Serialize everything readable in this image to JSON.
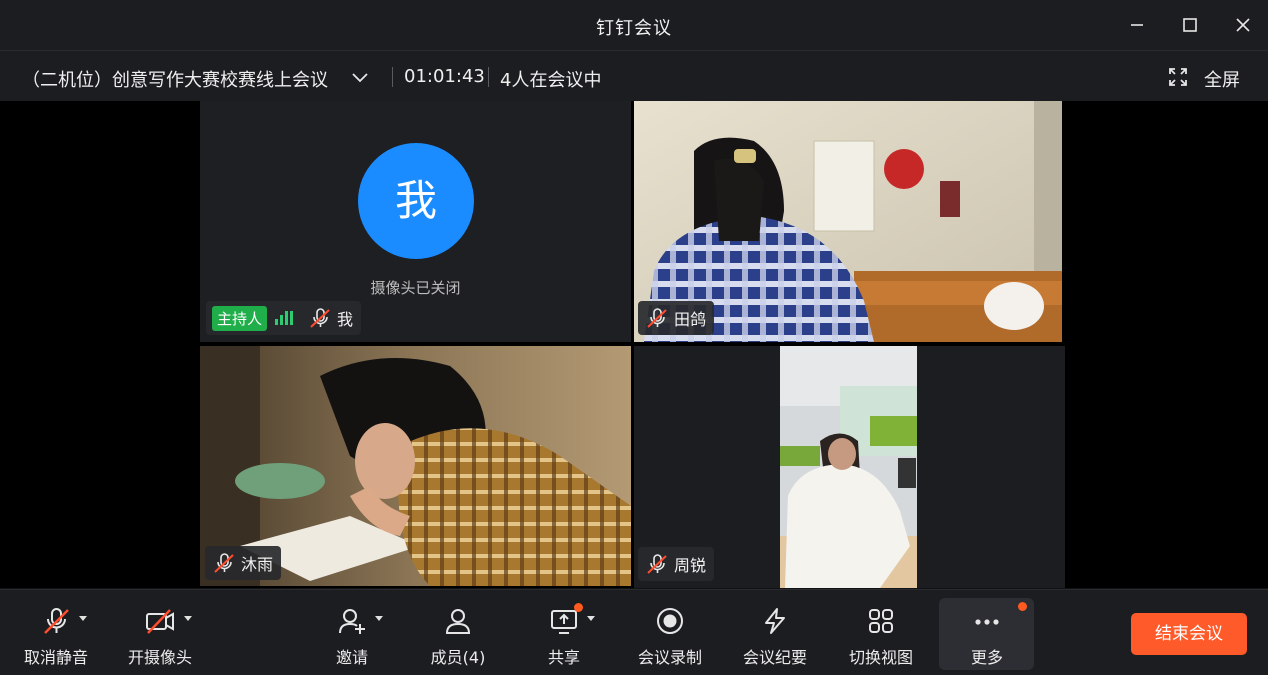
{
  "window": {
    "title": "钉钉会议",
    "controls": [
      "minimize-icon",
      "maximize-icon",
      "close-icon"
    ]
  },
  "meeting": {
    "title": "（二机位）创意写作大赛校赛线上会议",
    "timer": "01:01:43",
    "participants_text": "4人在会议中",
    "fullscreen_label": "全屏"
  },
  "tiles": [
    {
      "name": "我",
      "avatar_text": "我",
      "camera_off_text": "摄像头已关闭",
      "host_label": "主持人",
      "muted": true
    },
    {
      "name": "田鸽",
      "muted": true
    },
    {
      "name": "沐雨",
      "muted": true
    },
    {
      "name": "周锐",
      "muted": true
    }
  ],
  "toolbar": {
    "unmute": "取消静音",
    "camera_on": "开摄像头",
    "invite": "邀请",
    "members": "成员(4)",
    "share": "共享",
    "record": "会议录制",
    "minutes": "会议纪要",
    "switch_view": "切换视图",
    "more": "更多",
    "end_meeting": "结束会议"
  },
  "colors": {
    "accent_blue": "#1a8cff",
    "host_green": "#1fae4a",
    "end_orange": "#ff5a2a",
    "notify_dot": "#ff5a1f"
  }
}
